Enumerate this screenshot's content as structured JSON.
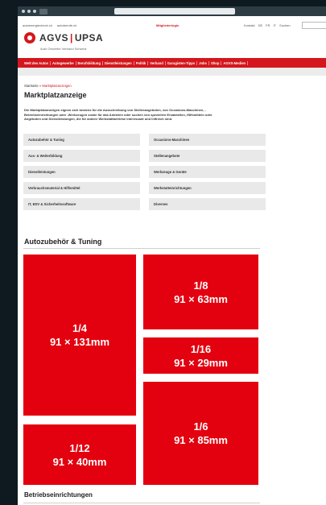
{
  "browser": {
    "url": ""
  },
  "header": {
    "links": [
      "autoenergiecheck.ch",
      "autoberufe.ch"
    ],
    "member_link": "Mitgliederlogin",
    "right_links": [
      "Kontakt",
      "DE",
      "FR",
      "IT",
      "Suchen"
    ],
    "logo_left": "AGVS",
    "logo_sep": "|",
    "logo_right": "UPSA",
    "tagline": "Auto Gewerbe Verband Schweiz"
  },
  "nav": {
    "items": [
      "Welt des Autos",
      "Autogewerbe",
      "Berufsbildung",
      "Dienstleistungen",
      "Politik",
      "Verband",
      "Garagisten-Tipps",
      "Jobs",
      "Shop",
      "AGVS-Medien"
    ]
  },
  "breadcrumb": {
    "home": "Startseite",
    "sep": " » ",
    "current": "Marktplatzanzeigen"
  },
  "main": {
    "title": "Marktplatzanzeige",
    "intro": "Die Marktplatzanzeigen eignen sich bestens für die Ausschreibung von Stellenangeboten, von Occasions-Maschinen, -Betriebseinrichtungen oder -Werkzeugen sowie für das Anbieten oder suchen von speziellen Ersatzteilen, Hilfsmitteln oder Angeboten und Dienstleistungen, die für andere Werkstattbetriebe interessant und hilfreich sind.",
    "categories": [
      "Autozubehör & Tuning",
      "Occasions-Maschinen",
      "Aus- & Weiterbildung",
      "Stellenangebote",
      "Dienstleistungen",
      "Werkzeuge & Geräte",
      "Verbrauchsmaterial & Hilfsmittel",
      "Werkstatteinrichtungen",
      "IT, EDV & Sicherheitssoftware",
      "Diverses"
    ]
  },
  "sections": [
    {
      "title": "Autozubehör & Tuning",
      "ads": [
        {
          "fraction": "1/4",
          "size": "91 × 131mm"
        },
        {
          "fraction": "1/8",
          "size": "91 × 63mm"
        },
        {
          "fraction": "1/16",
          "size": "91 × 29mm"
        },
        {
          "fraction": "1/6",
          "size": "91 × 85mm"
        },
        {
          "fraction": "1/12",
          "size": "91 × 40mm"
        }
      ]
    },
    {
      "title": "Betriebseinrichtungen"
    }
  ],
  "colors": {
    "accent": "#e3000f",
    "nav": "#d4171d"
  }
}
